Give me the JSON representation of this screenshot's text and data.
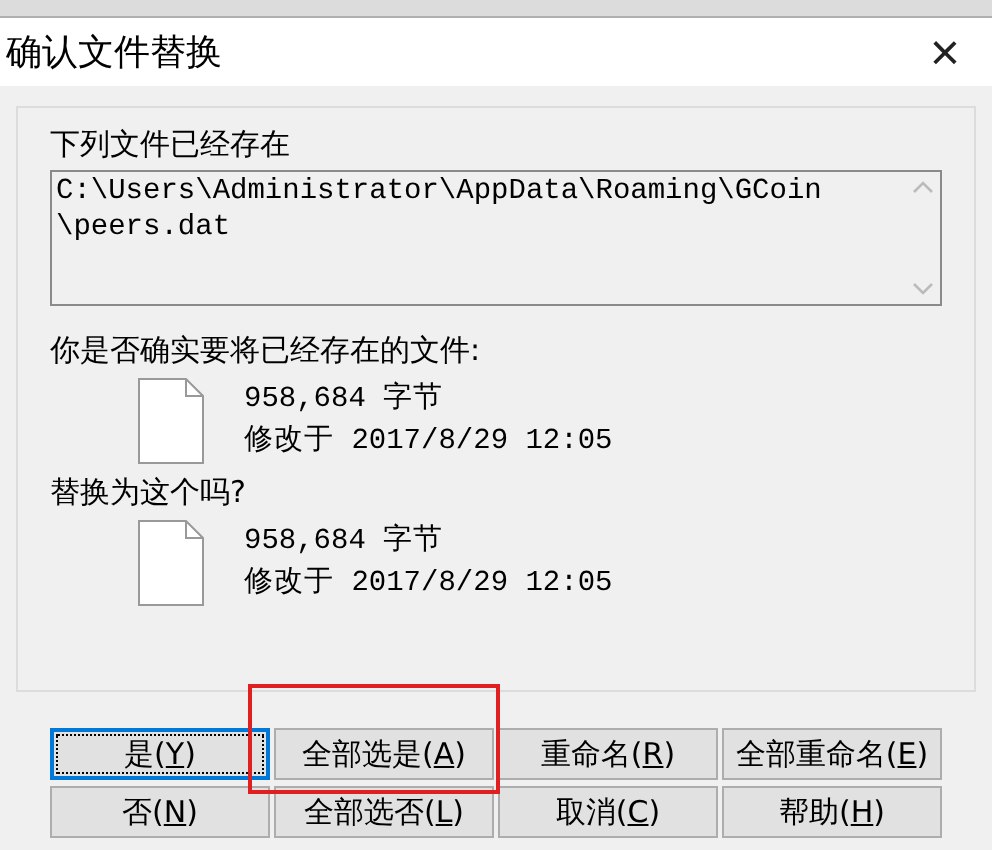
{
  "window": {
    "title": "确认文件替换",
    "close": "×"
  },
  "group": {
    "heading": "下列文件已经存在",
    "path": "C:\\Users\\Administrator\\AppData\\Roaming\\GCoin\n\\peers.dat",
    "question": "你是否确实要将已经存在的文件:",
    "existing": {
      "size": "958,684 字节",
      "modified": "修改于 2017/8/29 12:05"
    },
    "replace_question": "替换为这个吗?",
    "replacement": {
      "size": "958,684 字节",
      "modified": "修改于 2017/8/29 12:05"
    }
  },
  "buttons": [
    {
      "text": "是(",
      "key": "Y",
      "rest": ")",
      "default": true,
      "highlighted": false
    },
    {
      "text": "全部选是(",
      "key": "A",
      "rest": ")",
      "default": false,
      "highlighted": true
    },
    {
      "text": "重命名(",
      "key": "R",
      "rest": ")",
      "default": false,
      "highlighted": false
    },
    {
      "text": "全部重命名(",
      "key": "E",
      "rest": ")",
      "default": false,
      "highlighted": false
    },
    {
      "text": "否(",
      "key": "N",
      "rest": ")",
      "default": false,
      "highlighted": false
    },
    {
      "text": "全部选否(",
      "key": "L",
      "rest": ")",
      "default": false,
      "highlighted": false
    },
    {
      "text": "取消(",
      "key": "C",
      "rest": ")",
      "default": false,
      "highlighted": false
    },
    {
      "text": "帮助(",
      "key": "H",
      "rest": ")",
      "default": false,
      "highlighted": false
    }
  ]
}
